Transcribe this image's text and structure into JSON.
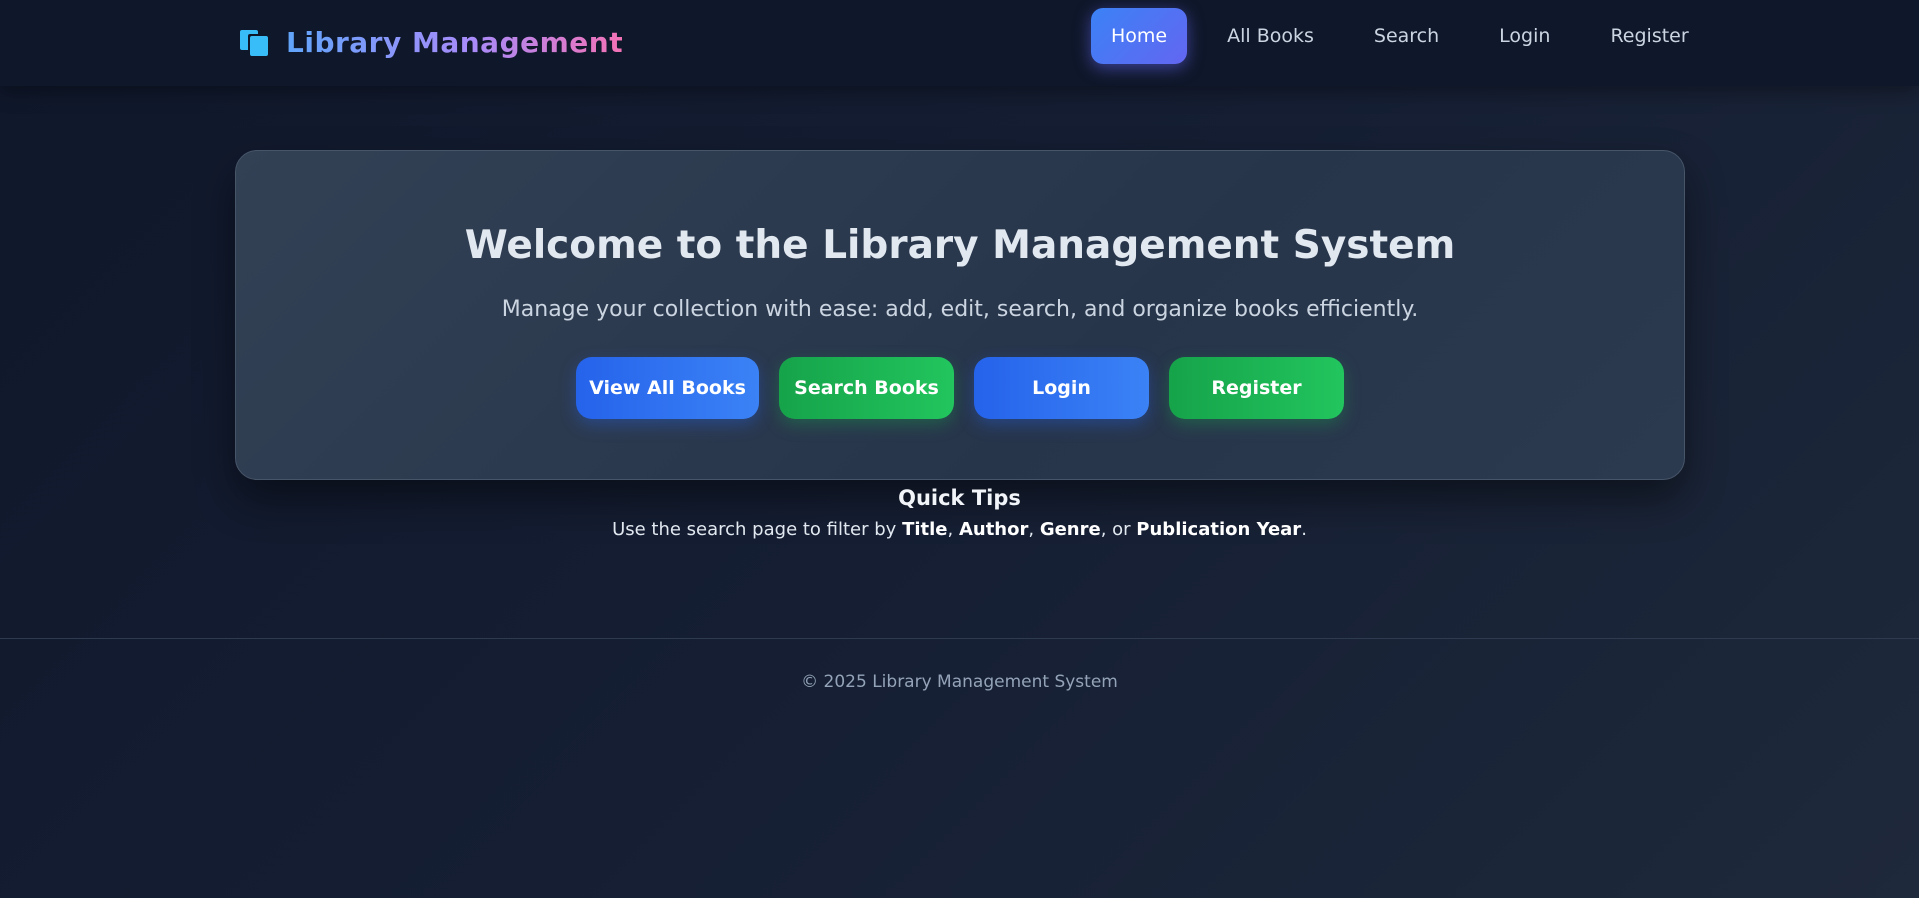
{
  "brand": {
    "title": "Library Management",
    "icon": "books-icon"
  },
  "nav": {
    "items": [
      {
        "label": "Home",
        "active": true
      },
      {
        "label": "All Books",
        "active": false
      },
      {
        "label": "Search",
        "active": false
      },
      {
        "label": "Login",
        "active": false
      },
      {
        "label": "Register",
        "active": false
      }
    ]
  },
  "hero": {
    "title": "Welcome to the Library Management System",
    "subtitle": "Manage your collection with ease: add, edit, search, and organize books efficiently.",
    "buttons": [
      {
        "label": "View All Books",
        "color": "#3b82f6"
      },
      {
        "label": "Search Books",
        "color": "#22c55e"
      },
      {
        "label": "Login",
        "color": "#3b82f6"
      },
      {
        "label": "Register",
        "color": "#22c55e"
      }
    ]
  },
  "tips": {
    "title": "Quick Tips",
    "prefix": "Use the search page to filter by ",
    "fields": [
      "Title",
      "Author",
      "Genre",
      "Publication Year"
    ],
    "sep1": ", ",
    "sep2": ", ",
    "sep3": ", or ",
    "suffix": "."
  },
  "footer": {
    "text": "© 2025 Library Management System"
  },
  "colors": {
    "background": "#0f172a",
    "accent_blue": "#3b82f6",
    "accent_green": "#22c55e",
    "active_nav": "#6366f1"
  }
}
